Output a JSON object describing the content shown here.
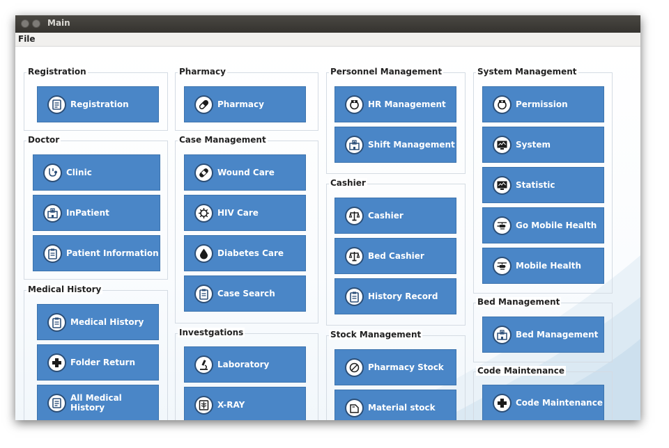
{
  "window": {
    "title": "Main"
  },
  "menu": {
    "file": "File"
  },
  "groups": {
    "registration": {
      "label": "Registration",
      "buttons": [
        "Registration"
      ]
    },
    "doctor": {
      "label": "Doctor",
      "buttons": [
        "Clinic",
        "InPatient",
        "Patient Information"
      ]
    },
    "medical_history": {
      "label": "Medical History",
      "buttons": [
        "Medical History",
        "Folder Return",
        "All Medical History"
      ]
    },
    "pharmacy": {
      "label": "Pharmacy",
      "buttons": [
        "Pharmacy"
      ]
    },
    "case_management": {
      "label": "Case Management",
      "buttons": [
        "Wound Care",
        "HIV Care",
        "Diabetes Care",
        "Case Search"
      ]
    },
    "investigations": {
      "label": "Investgations",
      "buttons": [
        "Laboratory",
        "X-RAY"
      ]
    },
    "personnel": {
      "label": "Personnel Management",
      "buttons": [
        "HR Management",
        "Shift Management"
      ]
    },
    "cashier": {
      "label": "Cashier",
      "buttons": [
        "Cashier",
        "Bed Cashier",
        "History Record"
      ]
    },
    "stock": {
      "label": "Stock Management",
      "buttons": [
        "Pharmacy Stock",
        "Material stock"
      ]
    },
    "system": {
      "label": "System Management",
      "buttons": [
        "Permission",
        "System",
        "Statistic",
        "Go Mobile Health",
        "Mobile Health"
      ]
    },
    "bed": {
      "label": "Bed Management",
      "buttons": [
        "Bed Management"
      ]
    },
    "code": {
      "label": "Code Maintenance",
      "buttons": [
        "Code Maintenance"
      ]
    }
  },
  "icons": {
    "registration": [
      "id-card-icon"
    ],
    "doctor": [
      "stethoscope-icon",
      "hospital-icon",
      "clipboard-icon"
    ],
    "medical_history": [
      "clipboard-icon",
      "medical-cross-icon",
      "id-card-icon"
    ],
    "pharmacy": [
      "pill-icon"
    ],
    "case_management": [
      "bandage-icon",
      "virus-icon",
      "drop-icon",
      "clipboard-icon"
    ],
    "investigations": [
      "microscope-icon",
      "xray-icon"
    ],
    "personnel": [
      "nurse-icon",
      "hospital-icon"
    ],
    "cashier": [
      "scales-icon",
      "scales-icon",
      "clipboard-icon"
    ],
    "stock": [
      "no-entry-icon",
      "box-icon"
    ],
    "system": [
      "nurse-icon",
      "monitor-icon",
      "monitor-icon",
      "helicopter-icon",
      "helicopter-icon"
    ],
    "bed": [
      "hospital-icon"
    ],
    "code": [
      "medical-cross-icon"
    ]
  },
  "colors": {
    "button": "#4a86c7",
    "button_border": "#3c73ad",
    "icon_ring": "#2c4f78"
  }
}
